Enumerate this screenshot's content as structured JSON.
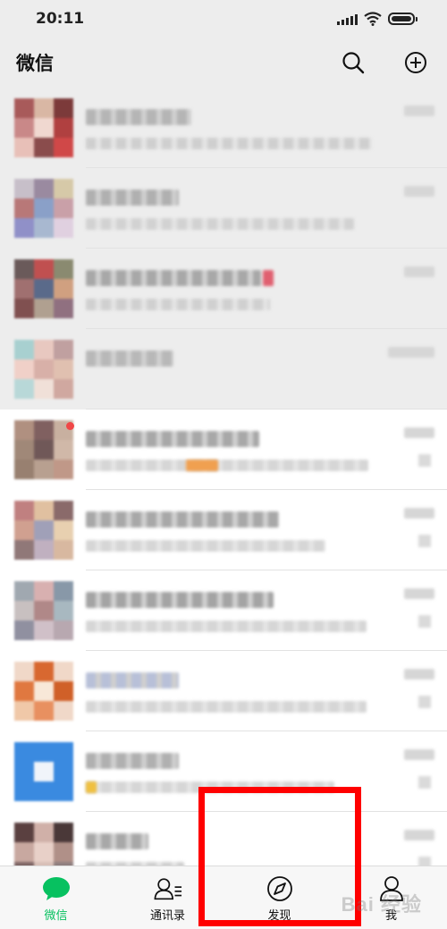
{
  "status_bar": {
    "time": "20:11"
  },
  "header": {
    "title": "微信",
    "search_icon": "search-icon",
    "add_icon": "plus-circle-icon"
  },
  "chat_list": {
    "items": [
      {
        "pinned": true,
        "unread": false,
        "avatar_colors": [
          "#a85a5a",
          "#d9b7a4",
          "#7c3a3a",
          "#c98888",
          "#f0d8d0",
          "#b04040",
          "#e8c0b8",
          "#8a4c4c",
          "#d04848"
        ],
        "name_width": 118,
        "msg_width": 320,
        "name_color": "#b5b5b5",
        "msg_color": "#cfcfcf",
        "accent": null
      },
      {
        "pinned": true,
        "unread": false,
        "avatar_colors": [
          "#c7bfc9",
          "#9a8aa0",
          "#d6c9a8",
          "#b87878",
          "#8aa0c8",
          "#c9a0a8",
          "#9090c8",
          "#a8b8d0",
          "#e0d0e0"
        ],
        "name_width": 104,
        "msg_width": 300,
        "name_color": "#b0b0b0",
        "msg_color": "#d2d2d2",
        "accent": null
      },
      {
        "pinned": true,
        "unread": false,
        "avatar_colors": [
          "#6a5a5a",
          "#c05050",
          "#8a8a70",
          "#a07070",
          "#5a6a8a",
          "#d0a080",
          "#805050",
          "#b0a090",
          "#907080"
        ],
        "name_width": 196,
        "msg_width": 206,
        "name_color": "#a8a8a8",
        "msg_color": "#d0d0d0",
        "accent": "#e06070"
      },
      {
        "pinned": true,
        "unread": false,
        "avatar_colors": [
          "#a8d0d0",
          "#e8c8c0",
          "#c0a0a0",
          "#f0d0c8",
          "#d8b0a8",
          "#e0c0b0",
          "#b8d8d8",
          "#f0e0d8",
          "#d0a8a0"
        ],
        "name_width": 98,
        "msg_width": 0,
        "name_color": "#b8b8b8",
        "msg_color": "#d0d0d0",
        "accent": null
      },
      {
        "pinned": false,
        "unread": true,
        "avatar_colors": [
          "#b09080",
          "#806060",
          "#c8b0a0",
          "#a08878",
          "#705858",
          "#d0b8a8",
          "#988070",
          "#b8a090",
          "#c09888"
        ],
        "name_width": 194,
        "msg_width": 316,
        "name_color": "#a8a8a8",
        "msg_color": "#d6d6d6",
        "accent": "#f0a050"
      },
      {
        "pinned": false,
        "unread": false,
        "avatar_colors": [
          "#c08080",
          "#e0c0a0",
          "#8a6a6a",
          "#d0a090",
          "#a0a0b8",
          "#e8d0b0",
          "#907878",
          "#c0b0c0",
          "#d8b8a0"
        ],
        "name_width": 216,
        "msg_width": 268,
        "name_color": "#a8a8a8",
        "msg_color": "#d6d6d6",
        "accent": null
      },
      {
        "pinned": false,
        "unread": false,
        "avatar_colors": [
          "#a0a8b0",
          "#d8b0b0",
          "#8898a8",
          "#c8c0c0",
          "#b08888",
          "#a8b8c0",
          "#9090a0",
          "#d0c0c8",
          "#b8a8b0"
        ],
        "name_width": 210,
        "msg_width": 314,
        "name_color": "#a4a4a4",
        "msg_color": "#d6d6d6",
        "accent": null
      },
      {
        "pinned": false,
        "unread": false,
        "avatar_colors": [
          "#f0d8c8",
          "#d86830",
          "#f0d8c8",
          "#e07840",
          "#f8e8d8",
          "#d06028",
          "#f0c8a8",
          "#e89060",
          "#f0d8c8"
        ],
        "name_width": 104,
        "msg_width": 314,
        "name_color": "#b8c0d8",
        "msg_color": "#d6d6d6",
        "accent": null
      },
      {
        "pinned": false,
        "unread": false,
        "avatar_colors": [
          "#3a8ae0",
          "#3a8ae0",
          "#3a8ae0",
          "#3a8ae0",
          "#f0f4fa",
          "#3a8ae0",
          "#3a8ae0",
          "#3a8ae0",
          "#3a8ae0"
        ],
        "name_width": 104,
        "msg_width": 278,
        "name_color": "#b0b0b0",
        "msg_color": "#d6d6d6",
        "accent": "#f0c040"
      },
      {
        "pinned": false,
        "unread": false,
        "avatar_colors": [
          "#5a4040",
          "#d0b0a8",
          "#4a3838",
          "#c8a8a0",
          "#e8d0c8",
          "#b09088",
          "#806868",
          "#d8c0b8",
          "#908080"
        ],
        "name_width": 70,
        "msg_width": 110,
        "name_color": "#a8a8a8",
        "msg_color": "#cfcfcf",
        "accent": null
      }
    ]
  },
  "tab_bar": {
    "tabs": [
      {
        "label": "微信",
        "icon": "chat-bubble-icon",
        "active": true
      },
      {
        "label": "通讯录",
        "icon": "contacts-icon",
        "active": false
      },
      {
        "label": "发现",
        "icon": "compass-icon",
        "active": false
      },
      {
        "label": "我",
        "icon": "person-icon",
        "active": false
      }
    ]
  },
  "watermark": {
    "text": "Bai 经验"
  },
  "colors": {
    "brand_green": "#07c160",
    "header_bg": "#ededed",
    "highlight_red": "#ff0000"
  }
}
